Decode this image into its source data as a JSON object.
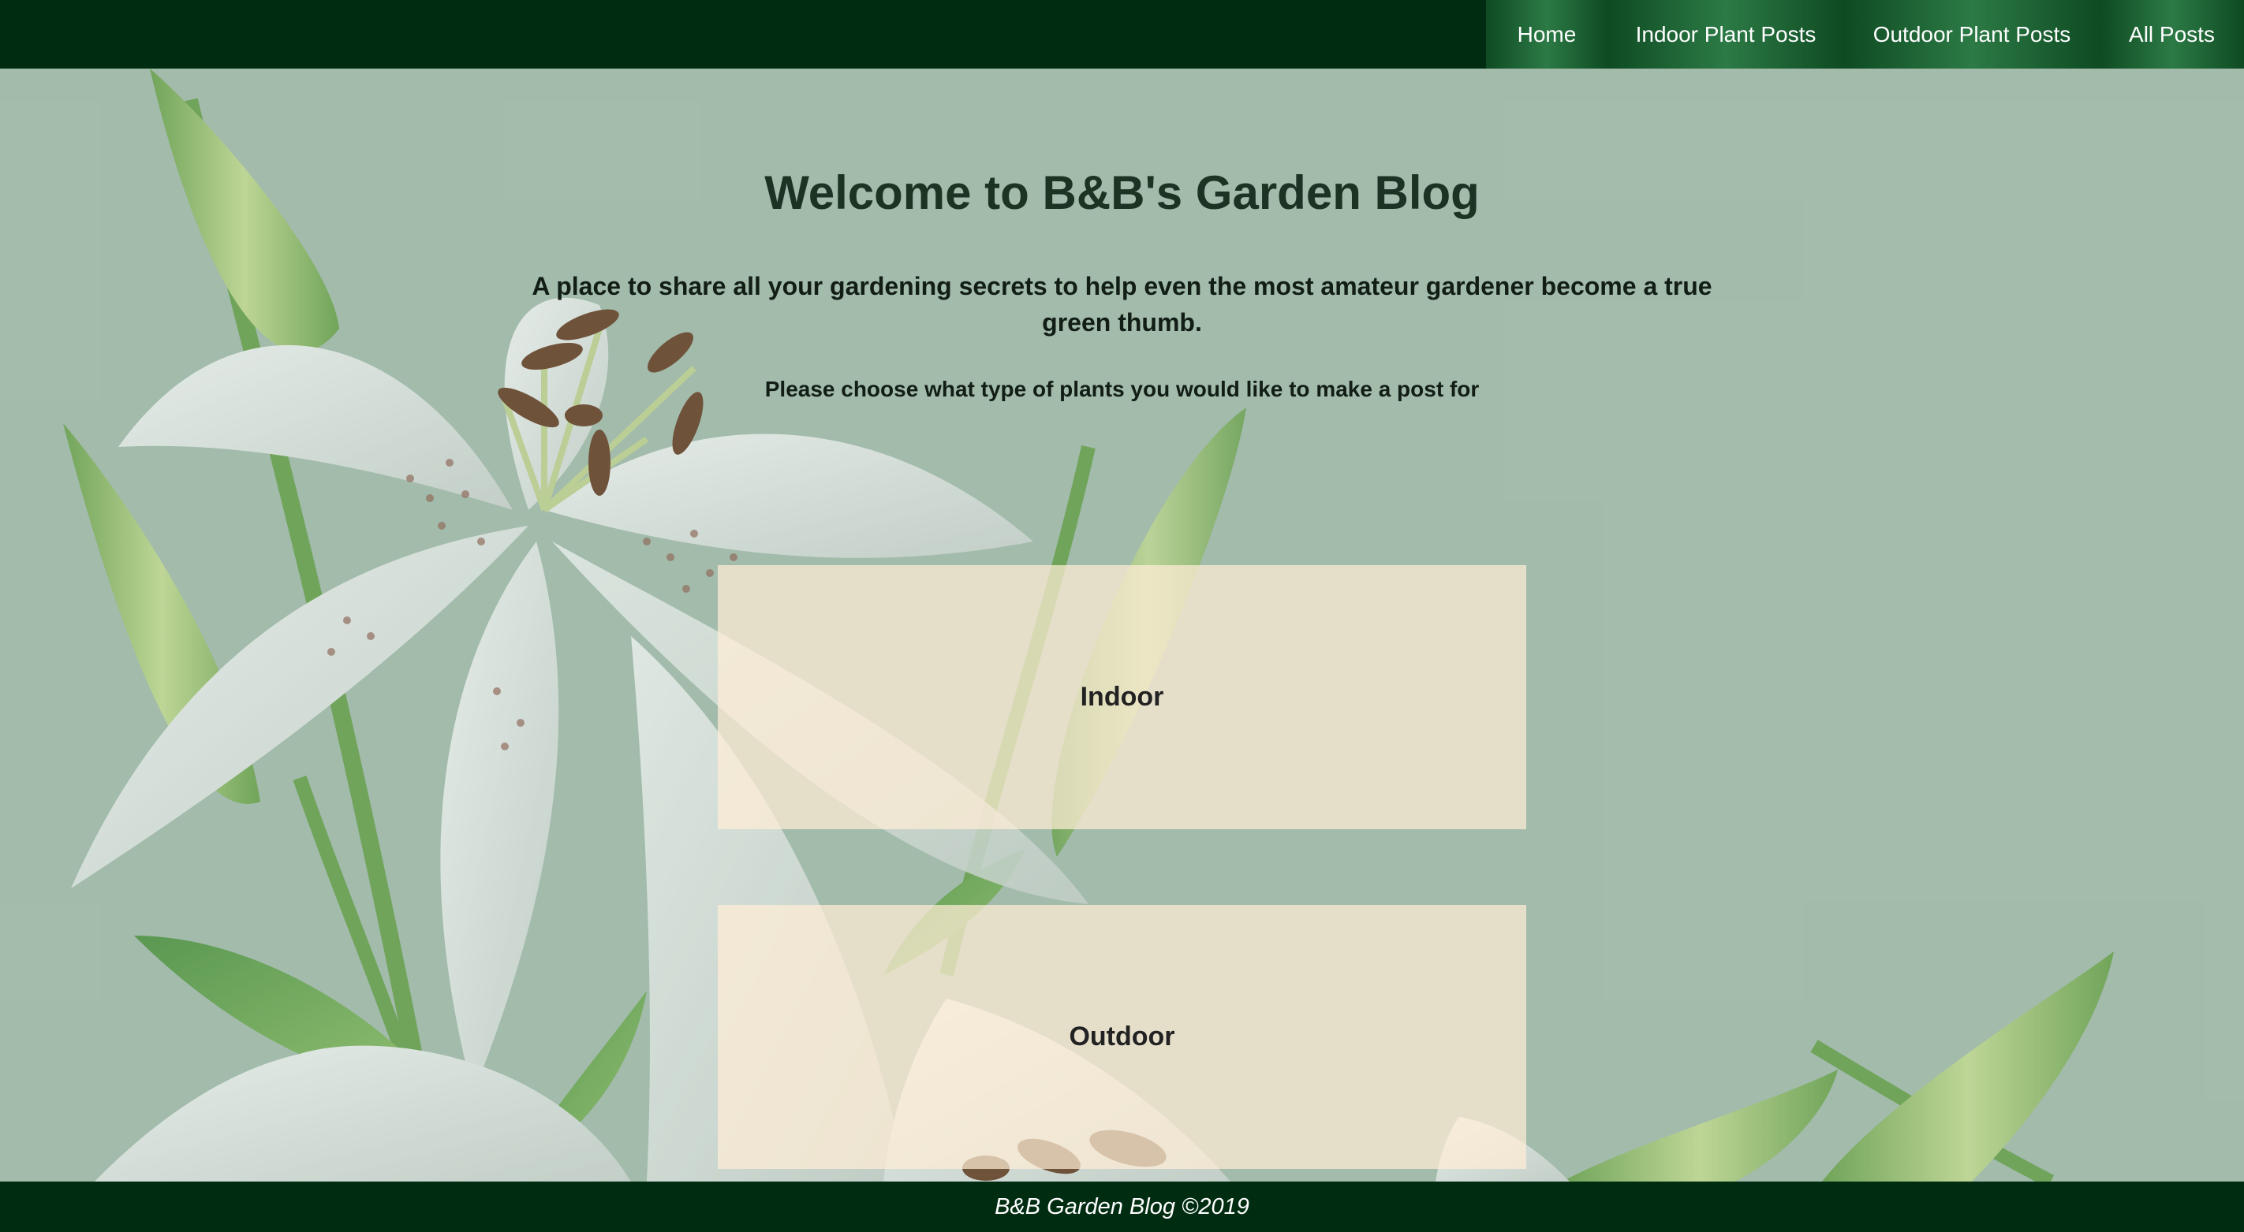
{
  "nav": {
    "items": [
      {
        "label": "Home"
      },
      {
        "label": "Indoor Plant Posts"
      },
      {
        "label": "Outdoor Plant Posts"
      },
      {
        "label": "All Posts"
      }
    ]
  },
  "main": {
    "title": "Welcome to B&B's Garden Blog",
    "tagline": "A place to share all your gardening secrets to help even the most amateur gardener become a true green thumb.",
    "prompt": "Please choose what type of plants you would like to make a post for",
    "choices": [
      {
        "label": "Indoor"
      },
      {
        "label": "Outdoor"
      }
    ]
  },
  "footer": {
    "text": "B&B Garden Blog ©2019"
  },
  "colors": {
    "nav_background": "#002d12",
    "nav_item_accent": "#2c7a45",
    "page_background": "#a3bcab",
    "choice_card": "#f2e4cc",
    "footer_background": "#002d12"
  },
  "background_image": "white-lily-flowers"
}
